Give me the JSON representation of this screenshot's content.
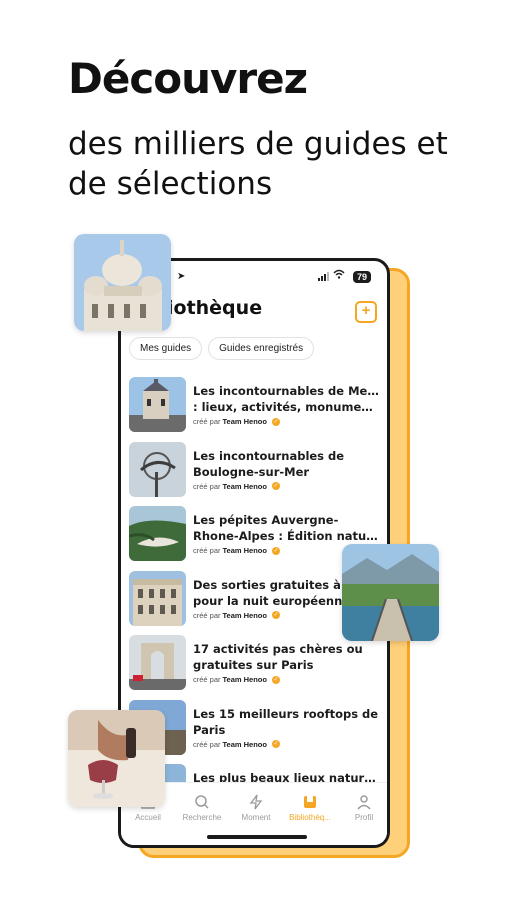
{
  "hero": {
    "title": "Découvrez",
    "subtitle": "des milliers de guides et de sélections"
  },
  "status_bar": {
    "battery": "79"
  },
  "screen": {
    "title": "iothèque",
    "add_icon": "plus-icon"
  },
  "tabs": [
    {
      "label": "Mes guides"
    },
    {
      "label": "Guides enregistrés"
    }
  ],
  "guides": [
    {
      "line1": "Les incontournables de Metz",
      "line2": ": lieux, activités, monumen...",
      "created_by": "créé par",
      "author": "Team Henoo"
    },
    {
      "line1": "Les incontournables de",
      "line2": "Boulogne-sur-Mer",
      "created_by": "créé par",
      "author": "Team Henoo"
    },
    {
      "line1": "Les pépites Auvergne-",
      "line2": "Rhone-Alpes : Édition nature",
      "created_by": "créé par",
      "author": "Team Henoo"
    },
    {
      "line1": "Des sorties gratuites à P",
      "line2": "pour la nuit européenne",
      "created_by": "créé par",
      "author": "Team Henoo"
    },
    {
      "line1": "17 activités pas chères ou",
      "line2": "gratuites sur Paris",
      "created_by": "créé par",
      "author": "Team Henoo"
    },
    {
      "line1": "Les 15 meilleurs rooftops de",
      "line2": "Paris",
      "created_by": "créé par",
      "author": "Team Henoo"
    },
    {
      "line1": "Les plus beaux lieux naturels",
      "line2": "",
      "created_by": "",
      "author": ""
    }
  ],
  "nav": [
    {
      "label": "Accueil",
      "icon": "home-icon"
    },
    {
      "label": "Recherche",
      "icon": "search-icon"
    },
    {
      "label": "Moment",
      "icon": "lightning-icon"
    },
    {
      "label": "Bibliothèq...",
      "icon": "library-icon"
    },
    {
      "label": "Profil",
      "icon": "user-icon"
    }
  ],
  "colors": {
    "accent": "#f5a623",
    "text": "#1c1c1c"
  }
}
